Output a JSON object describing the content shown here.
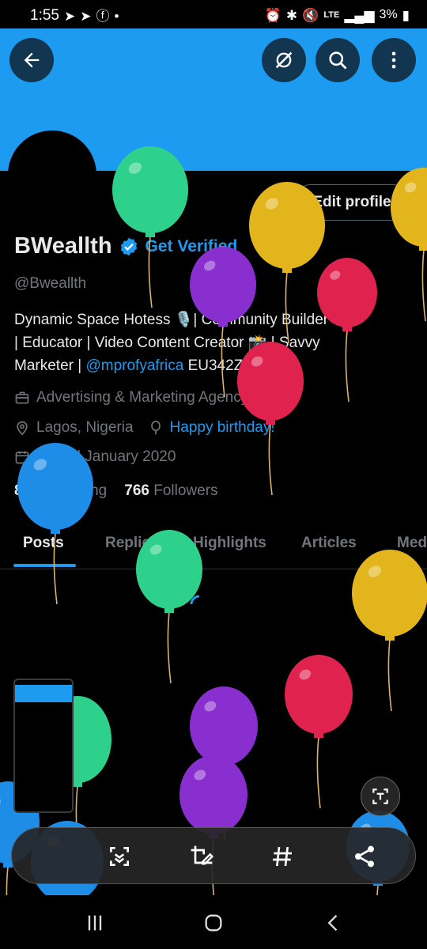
{
  "status_bar": {
    "time": "1:55",
    "battery": "3%",
    "network": "LTE",
    "icons": [
      "telegram-icon",
      "telegram-icon",
      "facebook-icon",
      "dot-icon",
      "alarm-icon",
      "bluetooth-icon",
      "mute-icon",
      "signal-icon",
      "battery-icon"
    ]
  },
  "header": {
    "back_icon": "arrow-left-icon",
    "grok_icon": "grok-icon",
    "search_icon": "search-icon",
    "more_icon": "more-vertical-icon"
  },
  "profile": {
    "edit_button": "Edit profile",
    "display_name": "BWeallth",
    "get_verified": "Get Verified",
    "handle": "@Bweallth",
    "bio_line1": "Dynamic Space Hotess 🎙️| Community Builder",
    "bio_line2": "| Educator |  Video Content Creator 📸 | Savvy",
    "bio_line3_prefix": "Marketer | ",
    "bio_mention": "@mprofyafrica",
    "bio_line3_suffix": " EU342ZB9",
    "category": "Advertising & Marketing Agency",
    "location": "Lagos, Nigeria",
    "birthday": "Happy birthday!",
    "joined": "Joined January 2020",
    "following_count": "806",
    "following_label": "Following",
    "followers_count": "766",
    "followers_label": "Followers"
  },
  "tabs": [
    {
      "label": "Posts",
      "active": true
    },
    {
      "label": "Replies",
      "active": false
    },
    {
      "label": "Highlights",
      "active": false
    },
    {
      "label": "Articles",
      "active": false
    },
    {
      "label": "Media",
      "active": false
    }
  ],
  "screenshot_toolbar": {
    "tools": [
      "scan-icon",
      "crop-edit-icon",
      "hashtag-icon",
      "share-icon"
    ],
    "text_extract_icon": "text-extract-icon"
  },
  "nav_bar": {
    "buttons": [
      "recents-icon",
      "home-icon",
      "back-icon"
    ]
  },
  "colors": {
    "accent": "#1d9bf0",
    "background": "#000000",
    "balloon_green": "#2ed18c",
    "balloon_yellow": "#e3b51c",
    "balloon_purple": "#8a2fcf",
    "balloon_red": "#e0224f",
    "balloon_blue": "#1d8de8"
  }
}
